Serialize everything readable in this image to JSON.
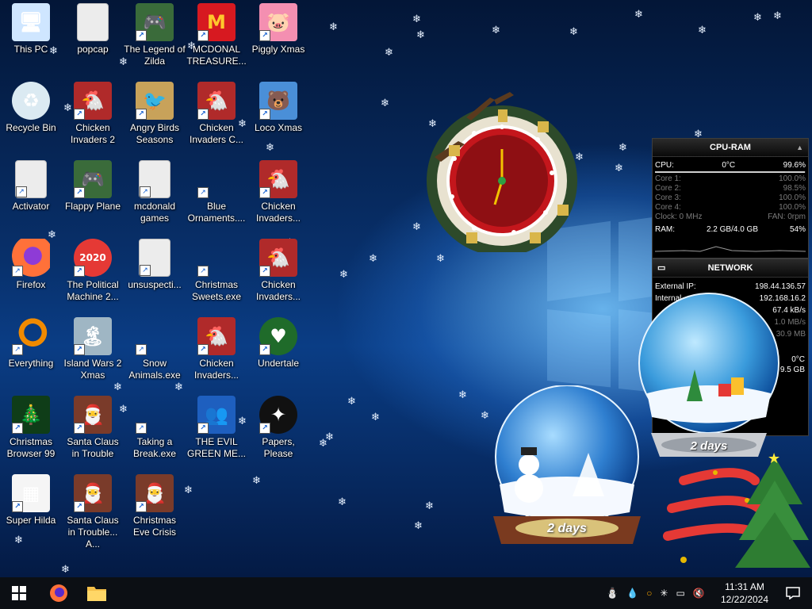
{
  "desktop": {
    "icons": [
      {
        "label": "This PC",
        "icon": "computer-icon"
      },
      {
        "label": "popcap",
        "icon": "folder-icon"
      },
      {
        "label": "The Legend of Zilda",
        "icon": "game-icon"
      },
      {
        "label": "MCDONAL TREASURE...",
        "icon": "mcdonalds-icon"
      },
      {
        "label": "Piggly Xmas",
        "icon": "pig-icon"
      },
      {
        "label": "Recycle Bin",
        "icon": "recycle-bin-icon"
      },
      {
        "label": "Chicken Invaders 2",
        "icon": "chicken-icon"
      },
      {
        "label": "Angry Birds Seasons",
        "icon": "angry-birds-icon"
      },
      {
        "label": "Chicken Invaders C...",
        "icon": "chicken-icon"
      },
      {
        "label": "Loco Xmas",
        "icon": "bear-icon"
      },
      {
        "label": "Activator",
        "icon": "file-icon"
      },
      {
        "label": "Flappy Plane",
        "icon": "game-icon"
      },
      {
        "label": "mcdonald games",
        "icon": "file-icon"
      },
      {
        "label": "Blue Ornaments....",
        "icon": "starburst-icon"
      },
      {
        "label": "Chicken Invaders...",
        "icon": "chicken-icon"
      },
      {
        "label": "Firefox",
        "icon": "firefox-icon"
      },
      {
        "label": "The Political Machine 2...",
        "icon": "badge-icon"
      },
      {
        "label": "unsuspecti...",
        "icon": "file-icon"
      },
      {
        "label": "Christmas Sweets.exe",
        "icon": "starburst-icon"
      },
      {
        "label": "Chicken Invaders...",
        "icon": "chicken-icon"
      },
      {
        "label": "Everything",
        "icon": "search-ring-icon"
      },
      {
        "label": "Island Wars 2 Xmas",
        "icon": "island-icon"
      },
      {
        "label": "Snow Animals.exe",
        "icon": "starburst-icon"
      },
      {
        "label": "Chicken Invaders...",
        "icon": "chicken-icon"
      },
      {
        "label": "Undertale",
        "icon": "undertale-icon"
      },
      {
        "label": "Christmas Browser 99",
        "icon": "tree-icon"
      },
      {
        "label": "Santa Claus in Trouble",
        "icon": "santa-icon"
      },
      {
        "label": "Taking a Break.exe",
        "icon": "starburst-icon"
      },
      {
        "label": "THE EVIL GREEN ME...",
        "icon": "msn-icon"
      },
      {
        "label": "Papers, Please",
        "icon": "papers-please-icon"
      },
      {
        "label": "Super Hilda",
        "icon": "pixel-icon"
      },
      {
        "label": "Santa Claus in Trouble... A...",
        "icon": "santa-icon"
      },
      {
        "label": "Christmas Eve Crisis",
        "icon": "santa-icon"
      }
    ]
  },
  "cpu_ram": {
    "title": "CPU-RAM",
    "cpu_label": "CPU:",
    "cpu_temp": "0°C",
    "cpu_pct": "99.6%",
    "cores": [
      {
        "label": "Core 1:",
        "value": "100.0%"
      },
      {
        "label": "Core 2:",
        "value": "98.5%"
      },
      {
        "label": "Core 3:",
        "value": "100.0%"
      },
      {
        "label": "Core 4:",
        "value": "100.0%"
      }
    ],
    "clock": "Clock: 0 MHz",
    "fan": "FAN: 0rpm",
    "ram_label": "RAM:",
    "ram_used": "2.2 GB/4.0 GB",
    "ram_pct": "54%"
  },
  "network": {
    "title": "NETWORK",
    "external_label": "External IP:",
    "external_ip": "198.44.136.57",
    "internal_label": "Internal",
    "internal_ip": "192.168.16.2",
    "speed": "67.4 kB/s",
    "rate": "1.0 MB/s",
    "total": "30.9 MB"
  },
  "extra_gadget": {
    "temp": "0°C",
    "size": "9.5 GB"
  },
  "snow_globes": {
    "left_label": "2 days",
    "right_label": "2 days"
  },
  "taskbar": {
    "start": "windows-icon",
    "pinned": [
      {
        "name": "Firefox",
        "icon": "firefox-icon"
      },
      {
        "name": "File Explorer",
        "icon": "folder-icon"
      }
    ],
    "time": "11:31 AM",
    "date": "12/22/2024"
  },
  "colors": {
    "accent": "#0a3d85",
    "taskbar": "#0c0f14",
    "clock_red": "#b3131a"
  }
}
